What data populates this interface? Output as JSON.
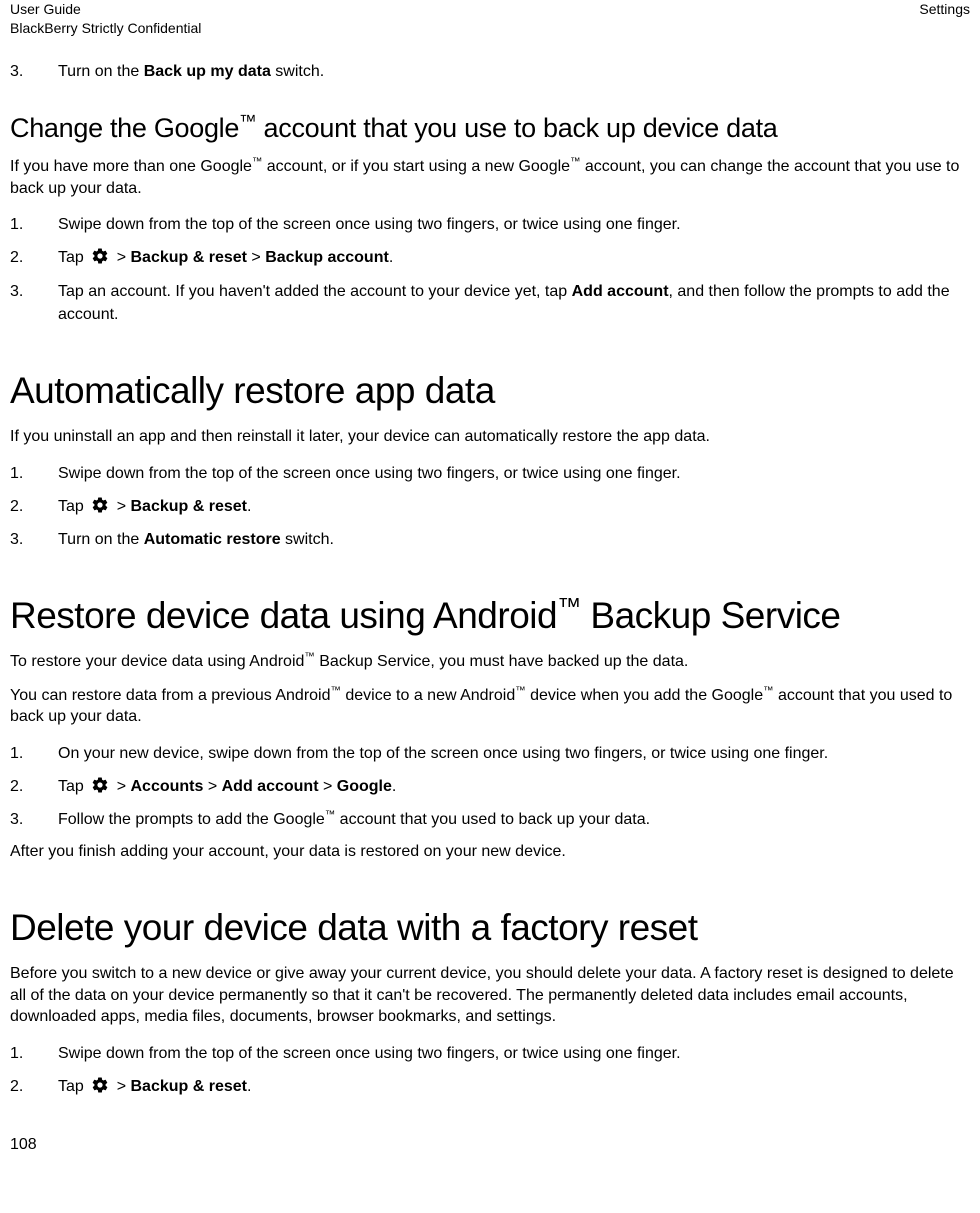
{
  "header": {
    "left_line1": "User Guide",
    "left_line2": "BlackBerry Strictly Confidential",
    "right": "Settings"
  },
  "intro_step": {
    "num": "3.",
    "pre": "Turn on the ",
    "bold": "Back up my data",
    "post": " switch."
  },
  "section1": {
    "title_pre": "Change the Google",
    "title_tm": "™",
    "title_post": " account that you use to back up device data",
    "p1_a": "If you have more than one Google",
    "p1_b": " account, or if you start using a new Google",
    "p1_c": " account, you can change the account that you use to back up your data.",
    "steps": [
      {
        "num": "1.",
        "text": "Swipe down from the top of the screen once using two fingers, or twice using one finger."
      },
      {
        "num": "2.",
        "pre": "Tap ",
        "icon": true,
        "mid": " > ",
        "bold1": "Backup & reset",
        "mid2": " > ",
        "bold2": "Backup account",
        "post": "."
      },
      {
        "num": "3.",
        "pre": "Tap an account. If you haven't added the account to your device yet, tap ",
        "bold1": "Add account",
        "post": ", and then follow the prompts to add the account."
      }
    ]
  },
  "section2": {
    "title": "Automatically restore app data",
    "p1": "If you uninstall an app and then reinstall it later, your device can automatically restore the app data.",
    "steps": [
      {
        "num": "1.",
        "text": "Swipe down from the top of the screen once using two fingers, or twice using one finger."
      },
      {
        "num": "2.",
        "pre": "Tap ",
        "icon": true,
        "mid": " > ",
        "bold1": "Backup & reset",
        "post": "."
      },
      {
        "num": "3.",
        "pre": "Turn on the ",
        "bold1": "Automatic restore",
        "post": " switch."
      }
    ]
  },
  "section3": {
    "title_pre": "Restore device data using Android",
    "title_tm": "™",
    "title_post": " Backup Service",
    "p1_a": "To restore your device data using Android",
    "p1_b": " Backup Service, you must have backed up the data.",
    "p2_a": "You can restore data from a previous Android",
    "p2_b": " device to a new Android",
    "p2_c": " device when you add the Google",
    "p2_d": " account that you used to back up your data.",
    "steps": [
      {
        "num": "1.",
        "text": "On your new device, swipe down from the top of the screen once using two fingers, or twice using one finger."
      },
      {
        "num": "2.",
        "pre": "Tap ",
        "icon": true,
        "mid": " > ",
        "bold1": "Accounts",
        "mid2": " > ",
        "bold2": "Add account",
        "mid3": " > ",
        "bold3": "Google",
        "post": "."
      },
      {
        "num": "3.",
        "pre": "Follow the prompts to add the Google",
        "tm": true,
        "post": " account that you used to back up your data."
      }
    ],
    "after": "After you finish adding your account, your data is restored on your new device."
  },
  "section4": {
    "title": "Delete your device data with a factory reset",
    "p1": "Before you switch to a new device or give away your current device, you should delete your data. A factory reset is designed to delete all of the data on your device permanently so that it can't be recovered. The permanently deleted data includes email accounts, downloaded apps, media files, documents, browser bookmarks, and settings.",
    "steps": [
      {
        "num": "1.",
        "text": "Swipe down from the top of the screen once using two fingers, or twice using one finger."
      },
      {
        "num": "2.",
        "pre": "Tap ",
        "icon": true,
        "mid": " > ",
        "bold1": "Backup & reset",
        "post": "."
      }
    ]
  },
  "page_number": "108"
}
